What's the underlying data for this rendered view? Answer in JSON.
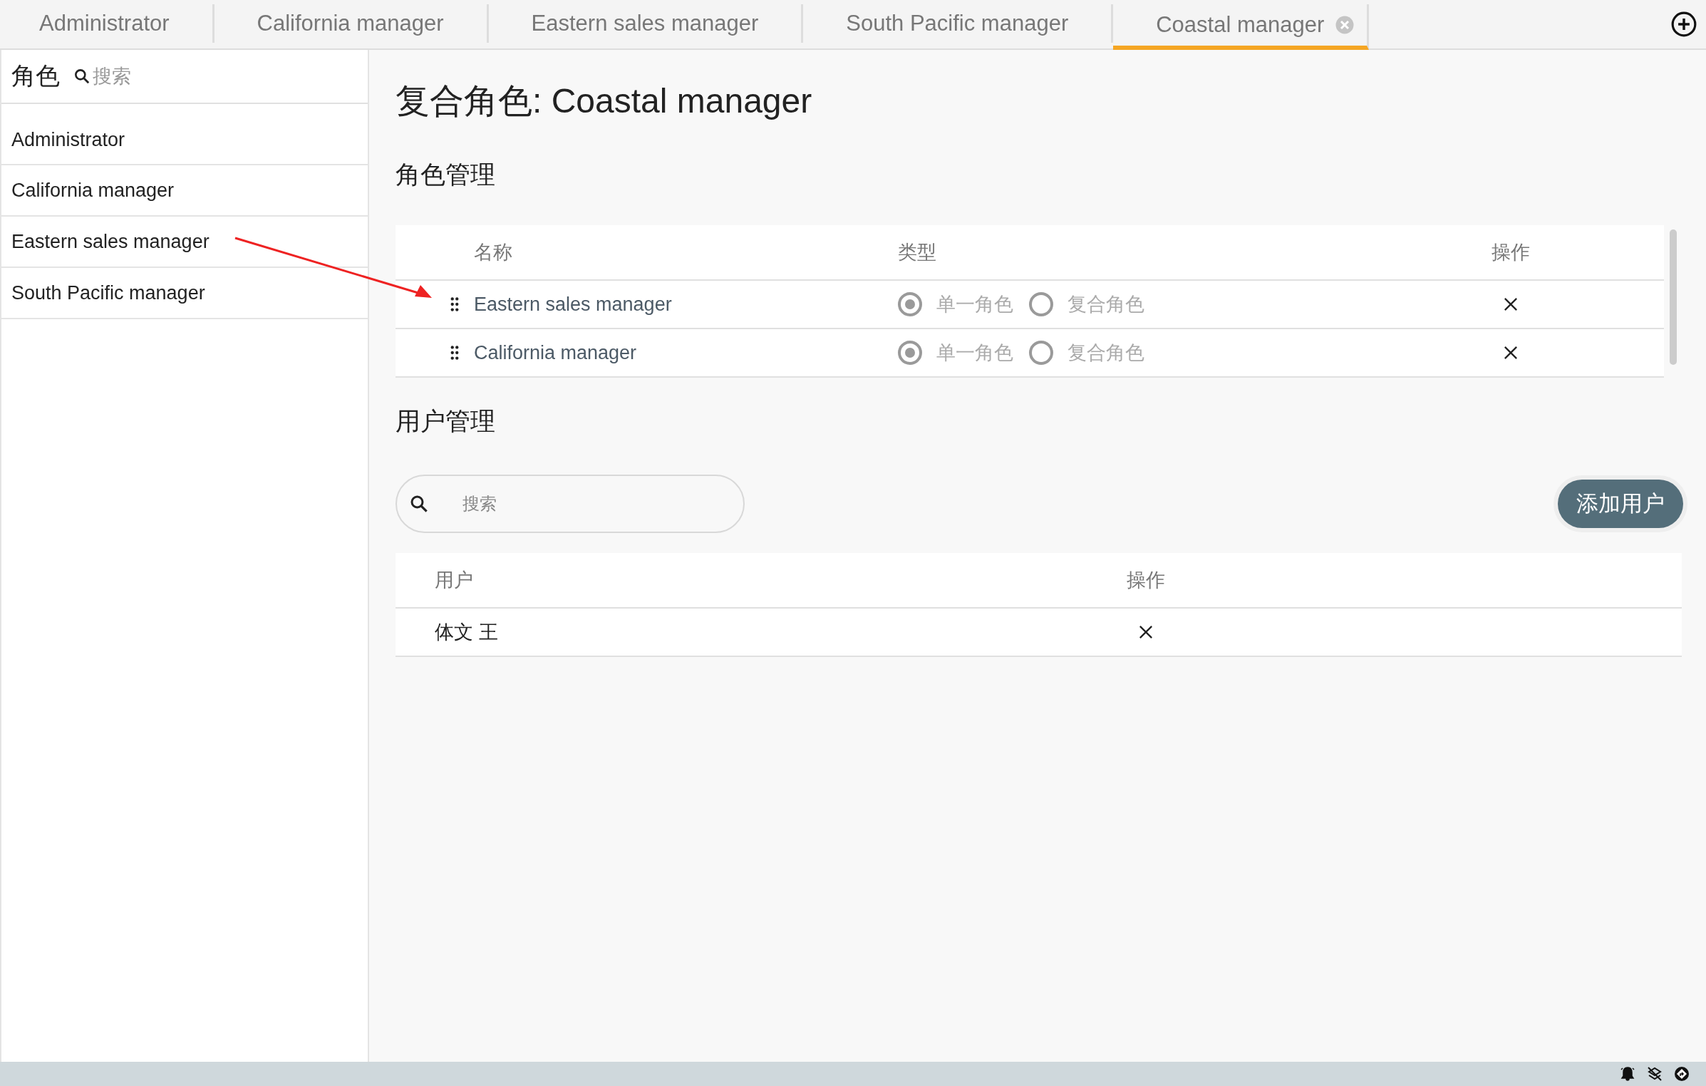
{
  "tabs": [
    {
      "label": "Administrator",
      "selected": false
    },
    {
      "label": "California manager",
      "selected": false
    },
    {
      "label": "Eastern sales manager",
      "selected": false
    },
    {
      "label": "South Pacific manager",
      "selected": false
    },
    {
      "label": "Coastal manager",
      "selected": true
    }
  ],
  "sidebar": {
    "title": "角色",
    "search": {
      "placeholder": "搜索"
    },
    "items": [
      "Administrator",
      "California manager",
      "Eastern sales manager",
      "South Pacific manager"
    ]
  },
  "main": {
    "title": "复合角色: Coastal manager",
    "role_section": {
      "heading": "角色管理",
      "columns": [
        "名称",
        "类型",
        "操作"
      ],
      "rows": [
        {
          "name": "Eastern sales manager",
          "disabled": true,
          "types": [
            {
              "label": "单一角色",
              "selected": true
            },
            {
              "label": "复合角色",
              "selected": false
            }
          ]
        },
        {
          "name": "California manager",
          "disabled": true,
          "types": [
            {
              "label": "单一角色",
              "selected": true
            },
            {
              "label": "复合角色",
              "selected": false
            }
          ]
        }
      ]
    },
    "user_section": {
      "heading": "用户管理",
      "search": {
        "placeholder": "搜索"
      },
      "add_button": "添加用户",
      "columns": [
        "用户",
        "操作"
      ],
      "rows": [
        {
          "user": "体文 王"
        }
      ]
    }
  }
}
